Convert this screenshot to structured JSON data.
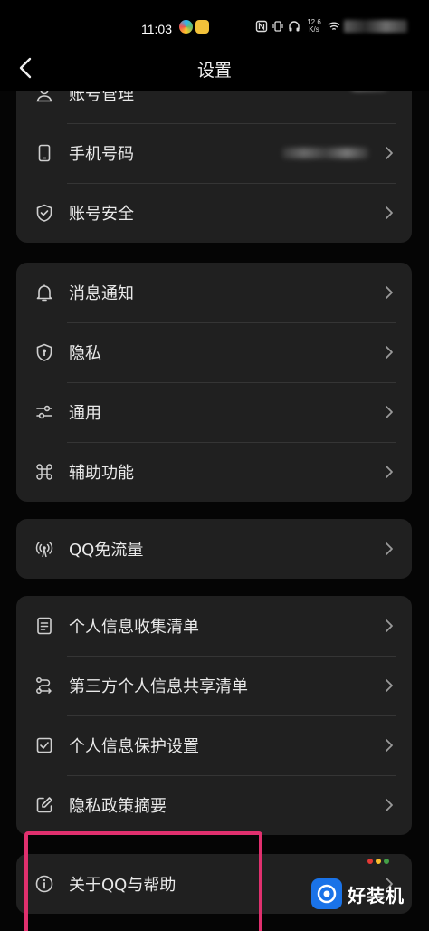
{
  "status_bar": {
    "time": "11:03",
    "net_speed": "12.6 K/s",
    "app_icons": [
      "colorful-app-icon",
      "yellow-app-icon"
    ],
    "system_icons": [
      "nfc-icon",
      "vibrate-icon",
      "headphones-icon",
      "wifi-icon",
      "signal-icon",
      "battery-icon"
    ]
  },
  "nav": {
    "title": "设置",
    "back_icon": "chevron-left-icon"
  },
  "groups": [
    {
      "id": "account",
      "items": [
        {
          "label": "账号管理",
          "icon": "person-icon",
          "value": "(blurred avatar)",
          "chevron": false
        },
        {
          "label": "手机号码",
          "icon": "phone-icon",
          "value": "(blurred number)",
          "chevron": true
        },
        {
          "label": "账号安全",
          "icon": "shield-check-icon",
          "chevron": true
        }
      ]
    },
    {
      "id": "general",
      "items": [
        {
          "label": "消息通知",
          "icon": "bell-icon",
          "chevron": true
        },
        {
          "label": "隐私",
          "icon": "privacy-shield-icon",
          "chevron": true
        },
        {
          "label": "通用",
          "icon": "sliders-icon",
          "chevron": true
        },
        {
          "label": "辅助功能",
          "icon": "command-icon",
          "chevron": true
        }
      ]
    },
    {
      "id": "data",
      "items": [
        {
          "label": "QQ免流量",
          "icon": "signal-tower-icon",
          "chevron": true
        }
      ]
    },
    {
      "id": "personal-info",
      "items": [
        {
          "label": "个人信息收集清单",
          "icon": "document-list-icon",
          "chevron": true
        },
        {
          "label": "第三方个人信息共享清单",
          "icon": "share-flow-icon",
          "chevron": true
        },
        {
          "label": "个人信息保护设置",
          "icon": "check-doc-icon",
          "chevron": true
        },
        {
          "label": "隐私政策摘要",
          "icon": "edit-doc-icon",
          "chevron": true
        }
      ]
    },
    {
      "id": "about",
      "items": [
        {
          "label": "关于QQ与帮助",
          "icon": "info-icon",
          "chevron": true
        }
      ]
    }
  ],
  "watermark": {
    "text": "好装机"
  },
  "colors": {
    "background": "#050505",
    "card": "#202020",
    "text": "#e9e9e9",
    "highlight": "#e0306e",
    "watermark": "#1a73e8"
  }
}
